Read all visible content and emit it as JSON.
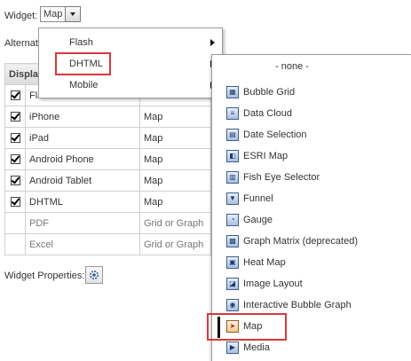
{
  "widget": {
    "label": "Widget:",
    "selected": "Map"
  },
  "alternate": {
    "label": "Alternat"
  },
  "table": {
    "header": "Displa",
    "rows": [
      {
        "name": "Fla",
        "checked": true,
        "widget": ""
      },
      {
        "name": "iPhone",
        "checked": true,
        "widget": "Map"
      },
      {
        "name": "iPad",
        "checked": true,
        "widget": "Map"
      },
      {
        "name": "Android Phone",
        "checked": true,
        "widget": "Map"
      },
      {
        "name": "Android Tablet",
        "checked": true,
        "widget": "Map"
      },
      {
        "name": "DHTML",
        "checked": true,
        "widget": "Map"
      },
      {
        "name": "PDF",
        "checked": false,
        "widget": "Grid or Graph"
      },
      {
        "name": "Excel",
        "checked": false,
        "widget": "Grid or Graph"
      }
    ]
  },
  "widget_properties": {
    "label": "Widget Properties:"
  },
  "menu": {
    "items": [
      {
        "label": "Flash"
      },
      {
        "label": "DHTML"
      },
      {
        "label": "Mobile"
      }
    ]
  },
  "submenu": {
    "none_label": "- none -",
    "items": [
      {
        "label": "Bubble Grid",
        "icon": "bubble-grid-icon",
        "glyph": "▦"
      },
      {
        "label": "Data Cloud",
        "icon": "data-cloud-icon",
        "glyph": "≡"
      },
      {
        "label": "Date Selection",
        "icon": "date-selection-icon",
        "glyph": "▤"
      },
      {
        "label": "ESRI Map",
        "icon": "esri-map-icon",
        "glyph": "◧"
      },
      {
        "label": "Fish Eye Selector",
        "icon": "fish-eye-selector-icon",
        "glyph": "▥"
      },
      {
        "label": "Funnel",
        "icon": "funnel-icon",
        "glyph": "▼"
      },
      {
        "label": "Gauge",
        "icon": "gauge-icon",
        "glyph": "◔"
      },
      {
        "label": "Graph Matrix (deprecated)",
        "icon": "graph-matrix-icon",
        "glyph": "▩"
      },
      {
        "label": "Heat Map",
        "icon": "heat-map-icon",
        "glyph": "▣"
      },
      {
        "label": "Image Layout",
        "icon": "image-layout-icon",
        "glyph": "◪"
      },
      {
        "label": "Interactive Bubble Graph",
        "icon": "interactive-bubble-graph-icon",
        "glyph": "◉"
      },
      {
        "label": "Map",
        "icon": "map-icon",
        "glyph": "➤"
      },
      {
        "label": "Media",
        "icon": "media-icon",
        "glyph": "▶"
      }
    ]
  },
  "colors": {
    "highlight": "#d8383d",
    "border": "#9c9c9c",
    "header_bg": "#dcdcdc"
  }
}
